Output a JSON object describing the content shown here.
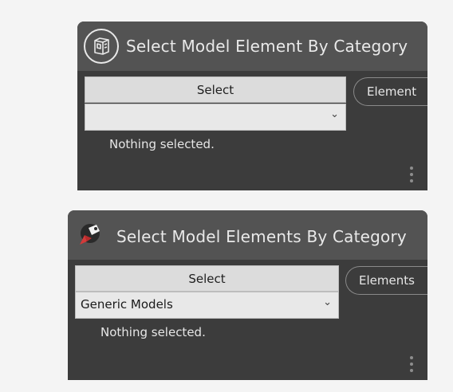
{
  "nodes": [
    {
      "title": "Select Model Element By Category",
      "icon": "cube-outline-icon",
      "select_label": "Select",
      "dropdown_value": "",
      "status": "Nothing selected.",
      "output_port": "Element"
    },
    {
      "title": "Select Model Elements By Category",
      "icon": "cursor-tag-icon",
      "select_label": "Select",
      "dropdown_value": "Generic Models",
      "status": "Nothing selected.",
      "output_port": "Elements"
    }
  ],
  "colors": {
    "node_body": "#3c3c3c",
    "node_header": "#535353",
    "button_bg": "#dcdcdc",
    "canvas": "#f4f4f4",
    "accent_red": "#d43a3a"
  }
}
